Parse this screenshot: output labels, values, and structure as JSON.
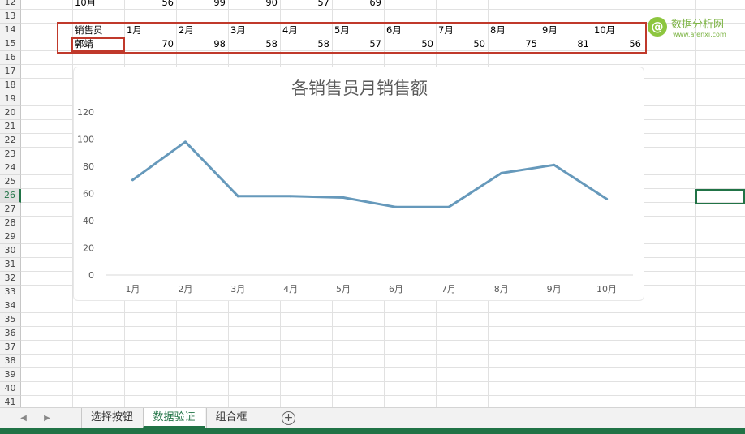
{
  "sheet": {
    "row_numbers": [
      "12",
      "13",
      "14",
      "15",
      "16",
      "17",
      "18",
      "19",
      "20",
      "21",
      "22",
      "23",
      "24",
      "25",
      "26",
      "27",
      "28",
      "29",
      "30",
      "31",
      "32",
      "33",
      "34",
      "35",
      "36",
      "37",
      "38",
      "39",
      "40",
      "41"
    ],
    "active_row": "26",
    "row12": {
      "label": "10月",
      "values": [
        "56",
        "99",
        "90",
        "57",
        "69"
      ]
    },
    "header_row": {
      "label": "销售员",
      "months": [
        "1月",
        "2月",
        "3月",
        "4月",
        "5月",
        "6月",
        "7月",
        "8月",
        "9月",
        "10月"
      ]
    },
    "data_row": {
      "label": "郭靖",
      "values": [
        "70",
        "98",
        "58",
        "58",
        "57",
        "50",
        "50",
        "75",
        "81",
        "56"
      ]
    }
  },
  "chart_data": {
    "type": "line",
    "title": "各销售员月销售额",
    "categories": [
      "1月",
      "2月",
      "3月",
      "4月",
      "5月",
      "6月",
      "7月",
      "8月",
      "9月",
      "10月"
    ],
    "series": [
      {
        "values": [
          70,
          98,
          58,
          58,
          57,
          50,
          50,
          75,
          81,
          56
        ]
      }
    ],
    "ylim": [
      0,
      120
    ],
    "yticks": [
      "0",
      "20",
      "40",
      "60",
      "80",
      "100",
      "120"
    ],
    "grid": false,
    "line_color": "#6699bb",
    "xlabel": "",
    "ylabel": ""
  },
  "tabs": {
    "items": [
      {
        "label": "选择按钮",
        "active": false
      },
      {
        "label": "数据验证",
        "active": true
      },
      {
        "label": "组合框",
        "active": false
      }
    ],
    "add_label": "+"
  },
  "watermark": {
    "logo_char": "@",
    "title": "数据分析网",
    "url": "www.afenxi.com"
  },
  "colors": {
    "excel_green": "#217346",
    "highlight_red": "#c0392b",
    "brand_green": "#8dc63f"
  }
}
